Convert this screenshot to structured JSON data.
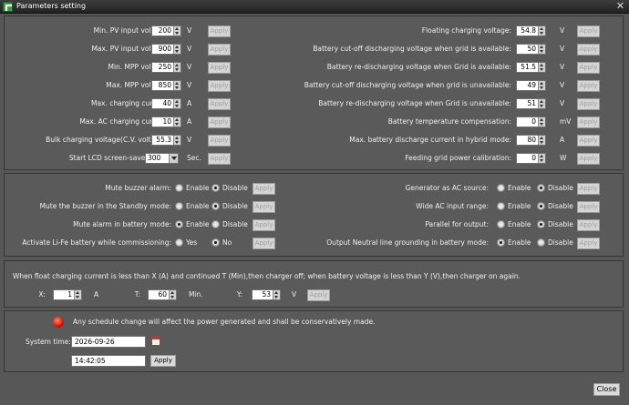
{
  "window": {
    "title": "Parameters setting",
    "close_label": "Close"
  },
  "apply_label": "Apply",
  "params_left": [
    {
      "label": "Min. PV input voltage:",
      "value": "200",
      "unit": "V"
    },
    {
      "label": "Max. PV input voltage:",
      "value": "900",
      "unit": "V"
    },
    {
      "label": "Min. MPP voltage:",
      "value": "250",
      "unit": "V"
    },
    {
      "label": "Max. MPP voltage:",
      "value": "850",
      "unit": "V"
    },
    {
      "label": "Max. charging current:",
      "value": "40",
      "unit": "A"
    },
    {
      "label": "Max. AC charging current:",
      "value": "10",
      "unit": "A"
    },
    {
      "label": "Bulk charging voltage(C.V. voltage):",
      "value": "55.3",
      "unit": "V"
    },
    {
      "label": "Start LCD screen-saver after:",
      "value": "300",
      "unit": "Sec."
    }
  ],
  "params_right": [
    {
      "label": "Floating charging voltage:",
      "value": "54.8",
      "unit": "V"
    },
    {
      "label": "Battery cut-off discharging voltage when grid is available:",
      "value": "50",
      "unit": "V"
    },
    {
      "label": "Battery re-discharging voltage when Grid is available:",
      "value": "51.5",
      "unit": "V"
    },
    {
      "label": "Battery cut-off discharging voltage when grid is unavailable:",
      "value": "49",
      "unit": "V"
    },
    {
      "label": "Battery re-discharging voltage when Grid is unavailable:",
      "value": "51",
      "unit": "V"
    },
    {
      "label": "Battery temperature compensation:",
      "value": "0",
      "unit": "mV"
    },
    {
      "label": "Max. battery discharge current in hybrid mode:",
      "value": "80",
      "unit": "A"
    },
    {
      "label": "Feeding grid power calibration:",
      "value": "0",
      "unit": "W"
    }
  ],
  "toggles_left": [
    {
      "label": "Mute buzzer alarm:",
      "opt1": "Enable",
      "opt2": "Disable",
      "selected": "Disable"
    },
    {
      "label": "Mute the buzzer in the Standby mode:",
      "opt1": "Enable",
      "opt2": "Disable",
      "selected": "Disable"
    },
    {
      "label": "Mute alarm in battery mode:",
      "opt1": "Enable",
      "opt2": "Disable",
      "selected": "Enable"
    },
    {
      "label": "Activate Li-Fe battery while commissioning:",
      "opt1": "Yes",
      "opt2": "No",
      "selected": "No"
    }
  ],
  "toggles_right": [
    {
      "label": "Generator as AC source:",
      "opt1": "Enable",
      "opt2": "Disable",
      "selected": "Disable"
    },
    {
      "label": "Wide AC input range:",
      "opt1": "Enable",
      "opt2": "Disable",
      "selected": "Disable"
    },
    {
      "label": "Parallel for output:",
      "opt1": "Enable",
      "opt2": "Disable",
      "selected": "Disable"
    },
    {
      "label": "Output Neutral line grounding in battery mode:",
      "opt1": "Enable",
      "opt2": "Disable",
      "selected": "Enable"
    }
  ],
  "float_rule": {
    "description": "When float charging current is less than X (A) and continued T (Min),then charger off; when battery voltage is less than Y (V),then charger on again.",
    "x_label": "X:",
    "x_value": "1",
    "x_unit": "A",
    "t_label": "T:",
    "t_value": "60",
    "t_unit": "Min.",
    "y_label": "Y:",
    "y_value": "53",
    "y_unit": "V"
  },
  "schedule": {
    "warning": "Any schedule change will affect the power generated and shall be conservatively made.",
    "system_time_label": "System time:",
    "date": "2026-09-26",
    "time": "14:42:05",
    "apply_label": "Apply"
  },
  "icons": {
    "app": "app-icon",
    "warning": "warning-icon",
    "calendar": "calendar-icon"
  },
  "colors": {
    "background": "#575757",
    "warning": "#d0150a"
  }
}
